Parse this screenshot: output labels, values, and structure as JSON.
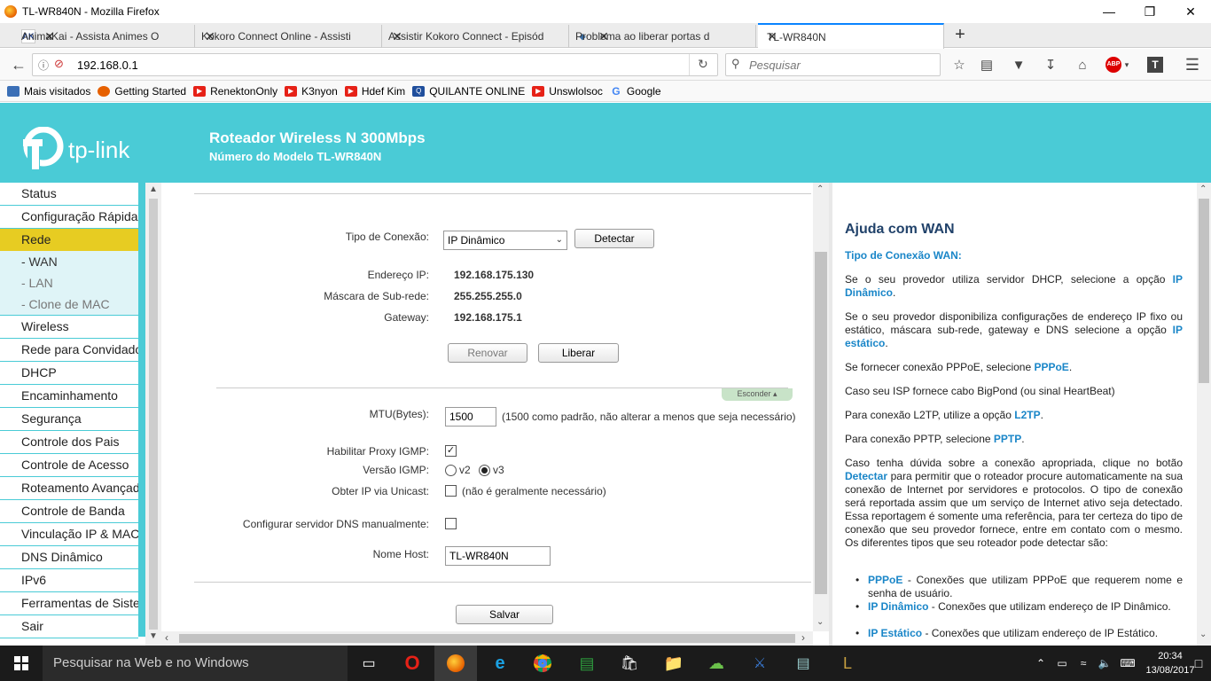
{
  "window": {
    "title": "TL-WR840N - Mozilla Firefox"
  },
  "tabs": [
    {
      "label": "AnimaKai - Assista Animes O",
      "icon": "ak-icon"
    },
    {
      "label": "Kokoro Connect Online - Assisti",
      "icon": "none"
    },
    {
      "label": "Assistir Kokoro Connect - Episód",
      "icon": "none"
    },
    {
      "label": "Problema ao liberar portas d",
      "icon": "forum-icon"
    },
    {
      "label": "TL-WR840N",
      "icon": "none"
    }
  ],
  "nav": {
    "url": "192.168.0.1",
    "search_placeholder": "Pesquisar"
  },
  "bookmarks": [
    {
      "label": "Mais visitados",
      "color": "#3b6fb6"
    },
    {
      "label": "Getting Started",
      "color": "#e66000"
    },
    {
      "label": "RenektonOnly",
      "color": "#e62117"
    },
    {
      "label": "K3nyon",
      "color": "#e62117"
    },
    {
      "label": "Hdef Kim",
      "color": "#e62117"
    },
    {
      "label": "QUILANTE ONLINE",
      "color": "#1f4e9c"
    },
    {
      "label": "Unswlolsoc",
      "color": "#e62117"
    },
    {
      "label": "Google",
      "color": "#4285f4"
    }
  ],
  "router": {
    "brand": "tp-link",
    "title": "Roteador Wireless N 300Mbps",
    "model": "Número do Modelo TL-WR840N",
    "accent": "#4acbd6",
    "active_color": "#e7cc22"
  },
  "menu": [
    {
      "label": "Status",
      "type": "main"
    },
    {
      "label": "Configuração Rápida",
      "type": "main"
    },
    {
      "label": "Rede",
      "type": "active"
    },
    {
      "label": "- WAN",
      "type": "sub"
    },
    {
      "label": "- LAN",
      "type": "subdim"
    },
    {
      "label": "- Clone de MAC",
      "type": "subdim"
    },
    {
      "label": "Wireless",
      "type": "main"
    },
    {
      "label": "Rede para Convidados",
      "type": "main"
    },
    {
      "label": "DHCP",
      "type": "main"
    },
    {
      "label": "Encaminhamento",
      "type": "main"
    },
    {
      "label": "Segurança",
      "type": "main"
    },
    {
      "label": "Controle dos Pais",
      "type": "main"
    },
    {
      "label": "Controle de Acesso",
      "type": "main"
    },
    {
      "label": "Roteamento Avançado",
      "type": "main"
    },
    {
      "label": "Controle de Banda",
      "type": "main"
    },
    {
      "label": "Vinculação IP & MAC",
      "type": "main"
    },
    {
      "label": "DNS Dinâmico",
      "type": "main"
    },
    {
      "label": "IPv6",
      "type": "main"
    },
    {
      "label": "Ferramentas de Sistema",
      "type": "main"
    },
    {
      "label": "Sair",
      "type": "main"
    }
  ],
  "wan": {
    "conn_type_label": "Tipo de Conexão:",
    "conn_type_value": "IP Dinâmico",
    "detect_btn": "Detectar",
    "ip_label": "Endereço IP:",
    "ip_value": "192.168.175.130",
    "mask_label": "Máscara de Sub-rede:",
    "mask_value": "255.255.255.0",
    "gw_label": "Gateway:",
    "gw_value": "192.168.175.1",
    "renew_btn": "Renovar",
    "release_btn": "Liberar",
    "hide_label": "Esconder",
    "mtu_label": "MTU(Bytes):",
    "mtu_value": "1500",
    "mtu_note": "(1500 como padrão, não alterar a menos que seja necessário)",
    "igmp_proxy_label": "Habilitar Proxy IGMP:",
    "igmp_proxy_checked": "✓",
    "igmp_ver_label": "Versão IGMP:",
    "igmp_v2": "v2",
    "igmp_v3": "v3",
    "unicast_label": "Obter IP via Unicast:",
    "unicast_note": "(não é geralmente necessário)",
    "dns_label": "Configurar servidor DNS manualmente:",
    "host_label": "Nome Host:",
    "host_value": "TL-WR840N",
    "save_btn": "Salvar"
  },
  "help": {
    "title": "Ajuda com WAN",
    "subtitle": "Tipo de Conexão WAN:",
    "p1a": "Se o seu provedor utiliza servidor DHCP, selecione a opção ",
    "p1b": "IP Dinâmico",
    "p1c": ".",
    "p2a": "Se o seu provedor disponibiliza configurações de endereço IP fixo ou estático, máscara sub-rede, gateway e DNS selecione a opção ",
    "p2b": "IP estático",
    "p2c": ".",
    "p3a": "Se fornecer conexão PPPoE, selecione ",
    "p3b": "PPPoE",
    "p3c": ".",
    "p4": "Caso seu ISP fornece cabo BigPond (ou sinal HeartBeat)",
    "p5a": "Para conexão L2TP, utilize a opção ",
    "p5b": "L2TP",
    "p5c": ".",
    "p6a": "Para conexão PPTP, selecione ",
    "p6b": "PPTP",
    "p6c": ".",
    "p7a": "Caso tenha dúvida sobre a conexão apropriada, clique no botão ",
    "p7b": "Detectar",
    "p7c": " para permitir que o roteador procure automaticamente na sua conexão de Internet por servidores e protocolos. O tipo de conexão será reportada assim que um serviço de Internet ativo seja detectado. Essa reportagem é somente uma referência, para ter certeza do tipo de conexão que seu provedor fornece, entre em contato com o mesmo. Os diferentes tipos que seu roteador pode detectar são:",
    "b1a": "PPPoE",
    "b1b": " - Conexões que utilizam PPPoE que requerem nome e senha de usuário.",
    "b2a": "IP Dinâmico",
    "b2b": " - Conexões que utilizam endereço de IP Dinâmico.",
    "b3a": "IP Estático",
    "b3b": " - Conexões que utilizam endereço de IP Estático."
  },
  "taskbar": {
    "search": "Pesquisar na Web e no Windows",
    "time": "20:34",
    "date": "13/08/2017"
  }
}
